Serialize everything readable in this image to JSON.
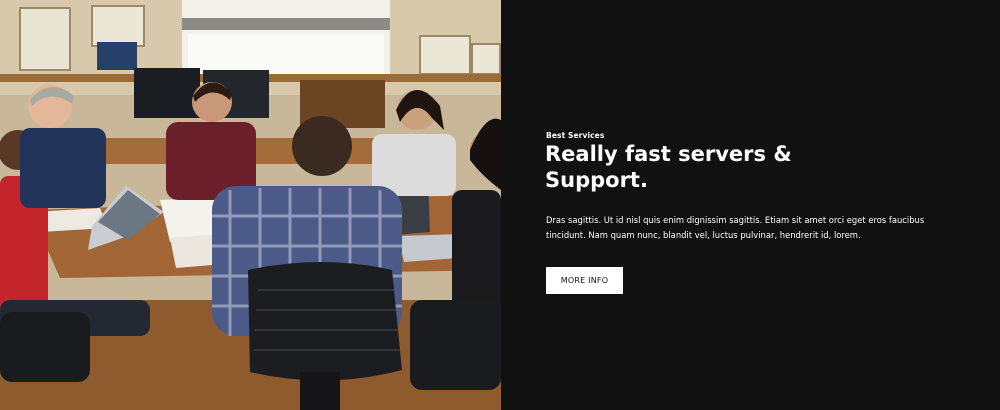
{
  "hero": {
    "eyebrow": "Best Services",
    "headline_line1": "Really fast servers &",
    "headline_line2": "Support.",
    "body": "Dras sagittis. Ut id nisl quis enim dignissim sagittis. Etiam sit amet orci eget eros faucibus tincidunt. Nam quam nunc, blandit vel, luctus pulvinar, hendrerit id, lorem.",
    "cta_label": "MORE INFO"
  },
  "colors": {
    "panel_background": "#111111",
    "text": "#ffffff",
    "button_background": "#ffffff",
    "button_text": "#111111"
  }
}
